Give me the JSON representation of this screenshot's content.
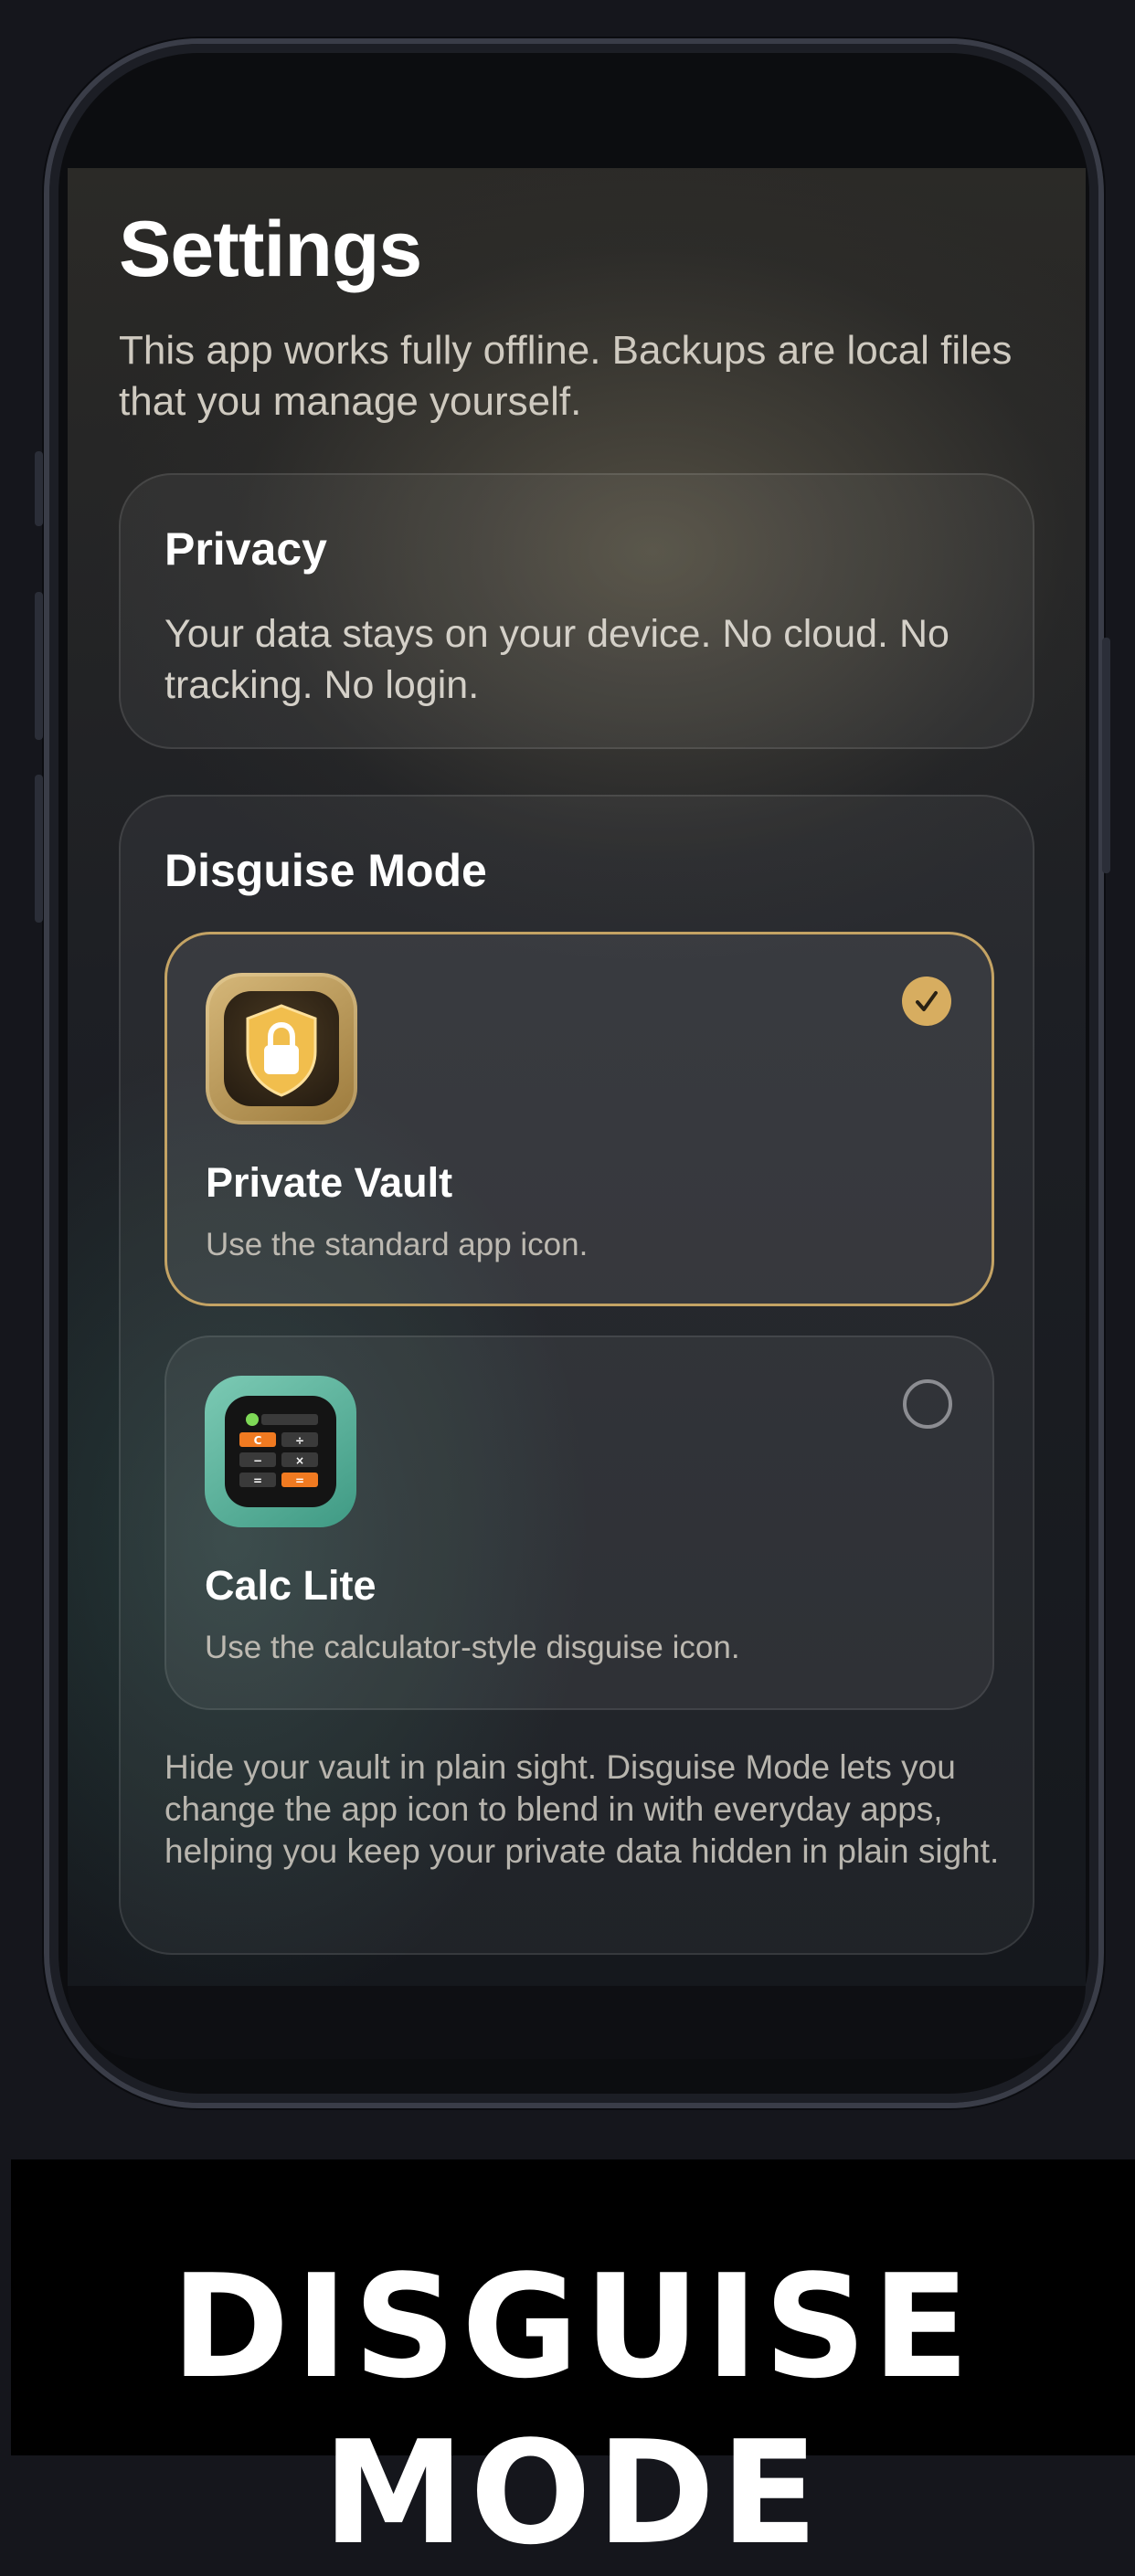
{
  "settings": {
    "title": "Settings",
    "subtitle": "This app works fully offline. Backups are local files that you manage yourself."
  },
  "privacy": {
    "title": "Privacy",
    "text": "Your data stays on your device. No cloud. No tracking. No login."
  },
  "disguise": {
    "title": "Disguise Mode",
    "options": [
      {
        "name": "Private Vault",
        "desc": "Use the standard app icon.",
        "icon": "shield-lock-icon",
        "selected": true
      },
      {
        "name": "Calc Lite",
        "desc": "Use the calculator-style disguise icon.",
        "icon": "calculator-icon",
        "selected": false
      }
    ],
    "footer": "Hide your vault in plain sight. Disguise Mode lets you change the app icon to blend in with everyday apps, helping you keep your private data hidden in plain sight."
  },
  "calc_icon_keys": [
    "C",
    "÷",
    "−",
    "×",
    "=",
    "="
  ],
  "banner": {
    "text": "DISGUISE MODE"
  },
  "colors": {
    "accent": "#d7ad60",
    "selected_border": "#c4a364",
    "calc_orange": "#f07a21",
    "calc_teal": "#5cb8a2"
  }
}
